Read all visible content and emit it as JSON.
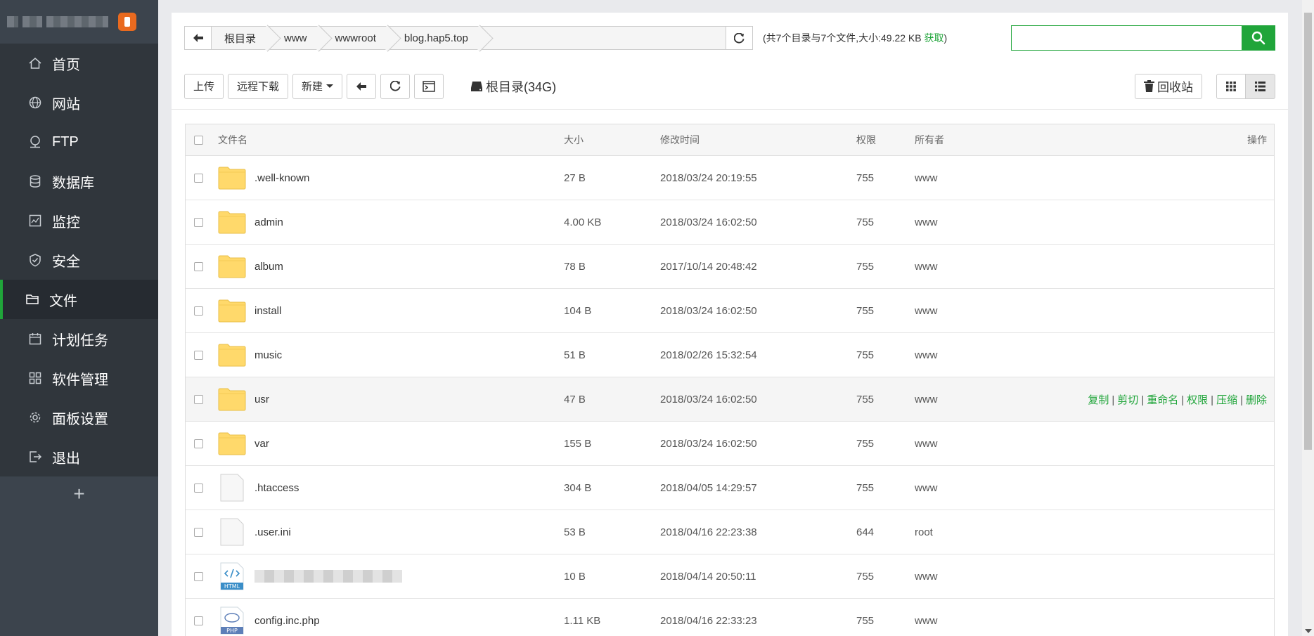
{
  "sidebar": {
    "nav": [
      {
        "label": "首页",
        "icon": "home-icon"
      },
      {
        "label": "网站",
        "icon": "globe-icon"
      },
      {
        "label": "FTP",
        "icon": "ftp-icon"
      },
      {
        "label": "数据库",
        "icon": "database-icon"
      },
      {
        "label": "监控",
        "icon": "monitor-icon"
      },
      {
        "label": "安全",
        "icon": "shield-icon"
      },
      {
        "label": "文件",
        "icon": "folder-icon"
      },
      {
        "label": "计划任务",
        "icon": "calendar-icon"
      },
      {
        "label": "软件管理",
        "icon": "grid-icon"
      },
      {
        "label": "面板设置",
        "icon": "gear-icon"
      },
      {
        "label": "退出",
        "icon": "logout-icon"
      }
    ],
    "active": "文件",
    "add_label": "+"
  },
  "breadcrumb": [
    "根目录",
    "www",
    "wwwroot",
    "blog.hap5.top"
  ],
  "summary": {
    "text": "(共7个目录与7个文件,大小:49.22 KB ",
    "link": "获取",
    "close": ")"
  },
  "search": {
    "placeholder": ""
  },
  "toolbar": {
    "upload": "上传",
    "remote_download": "远程下载",
    "new": "新建",
    "disk": "根目录(34G)",
    "recycle": "回收站"
  },
  "table": {
    "headers": {
      "name": "文件名",
      "size": "大小",
      "time": "修改时间",
      "perm": "权限",
      "owner": "所有者",
      "op": "操作"
    },
    "rows": [
      {
        "name": ".well-known",
        "type": "folder",
        "size": "27 B",
        "time": "2018/03/24 20:19:55",
        "perm": "755",
        "owner": "www"
      },
      {
        "name": "admin",
        "type": "folder",
        "size": "4.00 KB",
        "time": "2018/03/24 16:02:50",
        "perm": "755",
        "owner": "www"
      },
      {
        "name": "album",
        "type": "folder",
        "size": "78 B",
        "time": "2017/10/14 20:48:42",
        "perm": "755",
        "owner": "www"
      },
      {
        "name": "install",
        "type": "folder",
        "size": "104 B",
        "time": "2018/03/24 16:02:50",
        "perm": "755",
        "owner": "www"
      },
      {
        "name": "music",
        "type": "folder",
        "size": "51 B",
        "time": "2018/02/26 15:32:54",
        "perm": "755",
        "owner": "www"
      },
      {
        "name": "usr",
        "type": "folder",
        "size": "47 B",
        "time": "2018/03/24 16:02:50",
        "perm": "755",
        "owner": "www"
      },
      {
        "name": "var",
        "type": "folder",
        "size": "155 B",
        "time": "2018/03/24 16:02:50",
        "perm": "755",
        "owner": "www"
      },
      {
        "name": ".htaccess",
        "type": "file",
        "size": "304 B",
        "time": "2018/04/05 14:29:57",
        "perm": "755",
        "owner": "www"
      },
      {
        "name": ".user.ini",
        "type": "file",
        "size": "53 B",
        "time": "2018/04/16 22:23:38",
        "perm": "644",
        "owner": "root"
      },
      {
        "name": "",
        "type": "html",
        "size": "10 B",
        "time": "2018/04/14 20:50:11",
        "perm": "755",
        "owner": "www"
      },
      {
        "name": "config.inc.php",
        "type": "php",
        "size": "1.11 KB",
        "time": "2018/04/16 22:33:23",
        "perm": "755",
        "owner": "www"
      }
    ],
    "hover_row": 5,
    "actions": [
      "复制",
      "剪切",
      "重命名",
      "权限",
      "压缩",
      "删除"
    ]
  },
  "icon_labels": {
    "html": "HTML",
    "php": "PHP"
  },
  "colors": {
    "accent": "#20a53a",
    "sidebar": "#3c444d",
    "folder": "#ffd96b"
  }
}
